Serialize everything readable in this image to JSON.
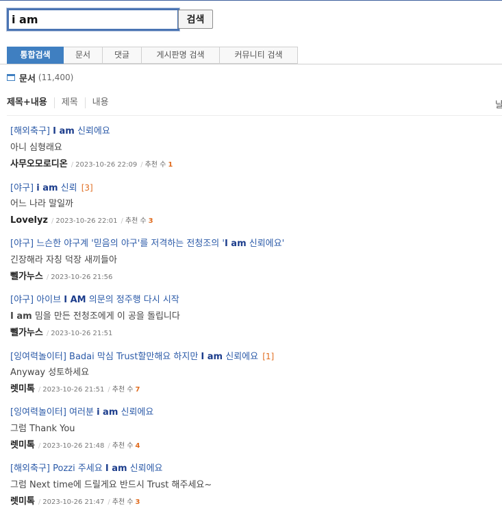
{
  "search": {
    "query": "i am",
    "button_label": "검색"
  },
  "tabs": [
    {
      "label": "통합검색",
      "active": true
    },
    {
      "label": "문서",
      "active": false
    },
    {
      "label": "댓글",
      "active": false
    },
    {
      "label": "게시판명 검색",
      "active": false
    },
    {
      "label": "커뮤니티 검색",
      "active": false
    }
  ],
  "section": {
    "title": "문서",
    "count": "(11,400)"
  },
  "filters": {
    "items": [
      "제목+내용",
      "제목",
      "내용"
    ],
    "right_label": "날"
  },
  "results": [
    {
      "category": "[해외축구]",
      "title_parts": [
        " ",
        "I am",
        " 신뢰에요"
      ],
      "comments": "",
      "snippet": "아니 심형래요",
      "author": "사무오모로디온",
      "date": "2023-10-26 22:09",
      "rec_label": "추천 수",
      "rec_value": "1"
    },
    {
      "category": "[야구]",
      "title_parts": [
        " ",
        "i am",
        " 신뢰"
      ],
      "comments": "[3]",
      "snippet": "어느 나라 말일까",
      "author": "Lovelyz",
      "date": "2023-10-26 22:01",
      "rec_label": "추천 수",
      "rec_value": "3"
    },
    {
      "category": "[야구]",
      "title_parts": [
        " 느슨한 야구계 '믿음의 야구'를 저격하는 전청조의 '",
        "I am",
        " 신뢰에요'"
      ],
      "comments": "",
      "snippet": "긴장해라 자칭 덕장 새끼들아",
      "author": "뻴가누스",
      "date": "2023-10-26 21:56",
      "rec_label": "",
      "rec_value": ""
    },
    {
      "category": "[야구]",
      "title_parts": [
        " 아이브 ",
        "I AM",
        " 의문의 정주행 다시 시작"
      ],
      "comments": "",
      "snippet_parts": [
        "I am",
        " 밈을 만든 전청조에게 이 공을 돌립니다"
      ],
      "author": "뻴가누스",
      "date": "2023-10-26 21:51",
      "rec_label": "",
      "rec_value": ""
    },
    {
      "category": "[잉여력놀이터]",
      "title_parts": [
        " Badai 막심 Trust할만해요 하지만 ",
        "I am",
        " 신뢰에요"
      ],
      "comments": "[1]",
      "snippet": "Anyway 성토하세요",
      "author": "렛미톡",
      "date": "2023-10-26 21:51",
      "rec_label": "추천 수",
      "rec_value": "7"
    },
    {
      "category": "[잉여력놀이터]",
      "title_parts": [
        " 여러분 ",
        "i am",
        " 신뢰에요"
      ],
      "comments": "",
      "snippet": "그럼 Thank You",
      "author": "렛미톡",
      "date": "2023-10-26 21:48",
      "rec_label": "추천 수",
      "rec_value": "4"
    },
    {
      "category": "[해외축구]",
      "title_parts": [
        " Pozzi 주세요 ",
        "I am",
        " 신뢰에요"
      ],
      "comments": "",
      "snippet": "그럼 Next time에 드릴게요 반드시 Trust 해주세요~",
      "author": "렛미톡",
      "date": "2023-10-26 21:47",
      "rec_label": "추천 수",
      "rec_value": "3"
    }
  ]
}
